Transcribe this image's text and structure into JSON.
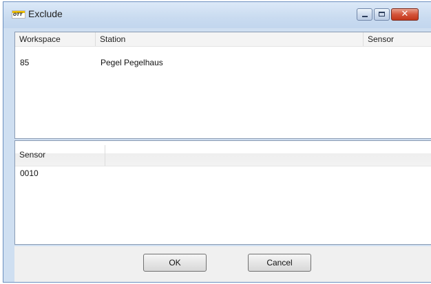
{
  "window": {
    "title": "Exclude",
    "app_icon_text": "OTT",
    "controls": {
      "minimize": "minimize-icon",
      "maximize": "maximize-icon",
      "close": "close-icon",
      "close_glyph": "✕"
    }
  },
  "top_grid": {
    "columns": [
      "Workspace",
      "Station",
      "Sensor"
    ],
    "rows": [
      [
        "85",
        "Pegel Pegelhaus",
        ""
      ]
    ]
  },
  "bottom_grid": {
    "columns": [
      "Sensor"
    ],
    "rows": [
      [
        "0010"
      ]
    ]
  },
  "buttons": {
    "ok": "OK",
    "cancel": "Cancel"
  }
}
